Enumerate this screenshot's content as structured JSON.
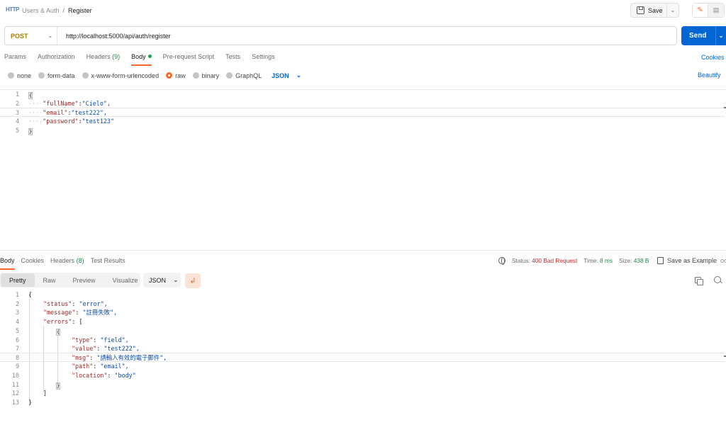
{
  "header": {
    "breadcrumb_parent": "Users & Auth",
    "breadcrumb_sep": "/",
    "breadcrumb_current": "Register",
    "save_label": "Save",
    "app_icon_text": "HTTP"
  },
  "request": {
    "method": "POST",
    "url": "http://localhost:5000/api/auth/register",
    "send_label": "Send",
    "tabs": [
      {
        "label": "Params"
      },
      {
        "label": "Authorization"
      },
      {
        "label": "Headers",
        "count": "(9)"
      },
      {
        "label": "Body"
      },
      {
        "label": "Pre-request Script"
      },
      {
        "label": "Tests"
      },
      {
        "label": "Settings"
      }
    ],
    "cookies_label": "Cookies",
    "body_types": [
      "none",
      "form-data",
      "x-www-form-urlencoded",
      "raw",
      "binary",
      "GraphQL"
    ],
    "body_format": "JSON",
    "beautify_label": "Beautify",
    "body_lines": [
      {
        "n": "1",
        "text": "{"
      },
      {
        "n": "2",
        "key": "\"fullName\"",
        "value": "\"Cielo\","
      },
      {
        "n": "3",
        "key": "\"email\"",
        "value": "\"test222\","
      },
      {
        "n": "4",
        "key": "\"password\"",
        "value": "\"test123\""
      },
      {
        "n": "5",
        "text": "}"
      }
    ]
  },
  "response": {
    "tabs": [
      {
        "label": "Body"
      },
      {
        "label": "Cookies"
      },
      {
        "label": "Headers",
        "count": "(8)"
      },
      {
        "label": "Test Results"
      }
    ],
    "status_label": "Status:",
    "status_value": "400 Bad Request",
    "time_label": "Time:",
    "time_value": "8 ms",
    "size_label": "Size:",
    "size_value": "438 B",
    "save_example_label": "Save as Example",
    "more_label": "oo",
    "views": [
      "Pretty",
      "Raw",
      "Preview",
      "Visualize"
    ],
    "format": "JSON",
    "line_numbers": [
      "1",
      "2",
      "3",
      "4",
      "5",
      "6",
      "7",
      "8",
      "9",
      "10",
      "11",
      "12",
      "13"
    ],
    "json": {
      "l1": "{",
      "status_key": "\"status\"",
      "status_val": "\"error\",",
      "message_key": "\"message\"",
      "message_val": "\"註冊失敗\",",
      "errors_key": "\"errors\"",
      "errors_open": "[",
      "obj_open": "{",
      "type_key": "\"type\"",
      "type_val": "\"field\",",
      "value_key": "\"value\"",
      "value_val": "\"test222\",",
      "msg_key": "\"msg\"",
      "msg_val": "\"請輸入有效的電子郵件\",",
      "path_key": "\"path\"",
      "path_val": "\"email\",",
      "location_key": "\"location\"",
      "location_val": "\"body\"",
      "obj_close": "}",
      "errors_close": "]",
      "l13": "}"
    }
  },
  "colors": {
    "accent": "#ef6c2a",
    "send": "#0265d2",
    "method": "#ad7a03",
    "status_error": "#c02a2a",
    "ok_green": "#1e8a4c"
  }
}
